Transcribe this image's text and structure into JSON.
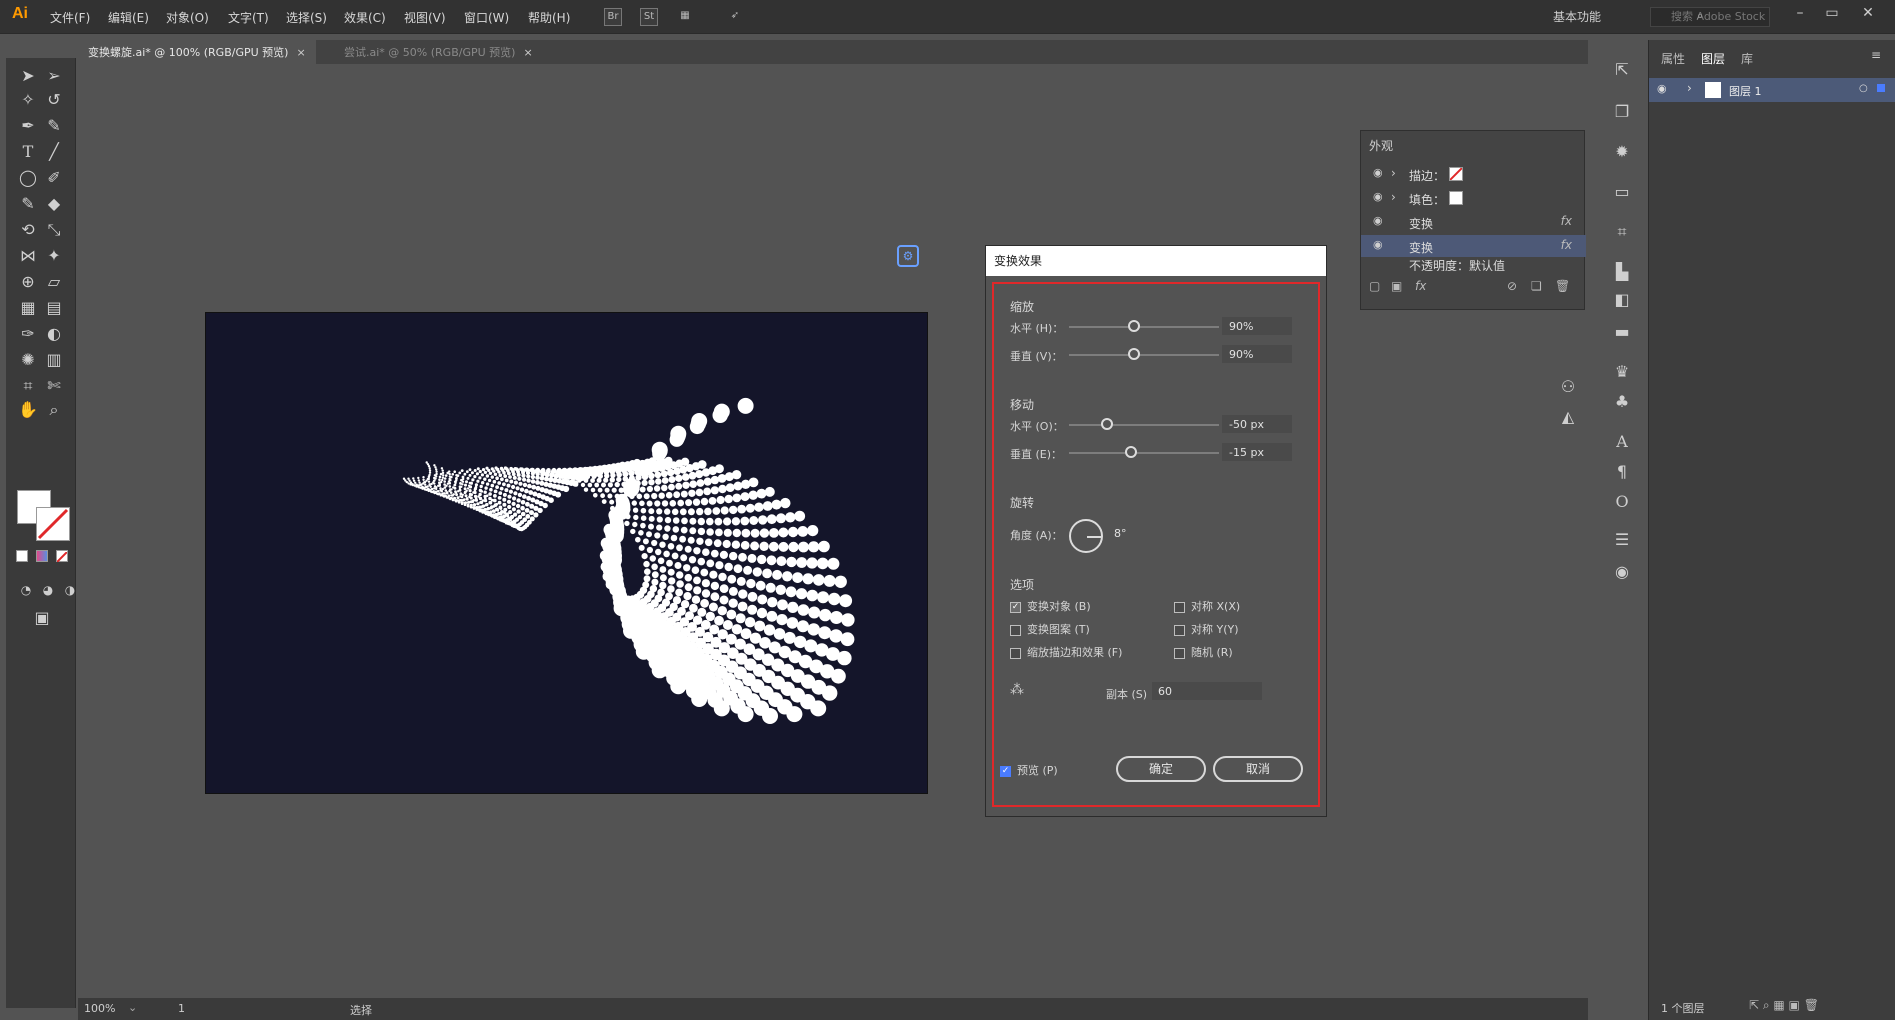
{
  "app": {
    "logo": "Ai"
  },
  "menu": [
    "文件(F)",
    "编辑(E)",
    "对象(O)",
    "文字(T)",
    "选择(S)",
    "效果(C)",
    "视图(V)",
    "窗口(W)",
    "帮助(H)"
  ],
  "toolbar_buttons": [
    "Br",
    "St"
  ],
  "workspace": "基本功能",
  "search_placeholder": "搜索 Adobe Stock",
  "tabs": [
    {
      "label": "变换螺旋.ai* @ 100% (RGB/GPU 预览)",
      "close": "×"
    },
    {
      "label": "尝试.ai* @ 50% (RGB/GPU 预览)",
      "close": "×"
    }
  ],
  "status": {
    "zoom": "100%",
    "artboard": "1",
    "tool": "选择"
  },
  "layers_panel": {
    "tabs": [
      "属性",
      "图层",
      "库"
    ],
    "layer_name": "图层 1",
    "footer": "1 个图层"
  },
  "appearance": {
    "title": "外观",
    "rows": [
      {
        "label": "描边："
      },
      {
        "label": "填色："
      },
      {
        "label": "变换"
      },
      {
        "label": "变换"
      },
      {
        "label": "不透明度：默认值"
      }
    ],
    "fx": "fx"
  },
  "dialog": {
    "title": "变换效果",
    "scale": {
      "section": "缩放",
      "h_label": "水平 (H)：",
      "h_value": "90%",
      "h_level": 0.9,
      "v_label": "垂直 (V)：",
      "v_value": "90%",
      "v_level": 0.9
    },
    "move": {
      "section": "移动",
      "h_label": "水平 (O)：",
      "h_value": "-50 px",
      "v_label": "垂直 (E)：",
      "v_value": "-15 px"
    },
    "rotate": {
      "section": "旋转",
      "angle_label": "角度 (A)：",
      "angle_value": "8°"
    },
    "options": {
      "section": "选项",
      "transform_objects": "变换对象 (B)",
      "transform_patterns": "变换图案 (T)",
      "scale_strokes": "缩放描边和效果 (F)",
      "reflect_x": "对称 X(X)",
      "reflect_y": "对称 Y(Y)",
      "random": "随机 (R)"
    },
    "copies_label": "副本 (S)",
    "copies_value": "60",
    "preview": "预览 (P)",
    "ok": "确定",
    "cancel": "取消",
    "checked": {
      "transform_objects": true,
      "preview": true
    }
  },
  "colors": {
    "artboard": "#14152a",
    "dialog_border": "#e0282a",
    "selection": "#4d5977"
  }
}
